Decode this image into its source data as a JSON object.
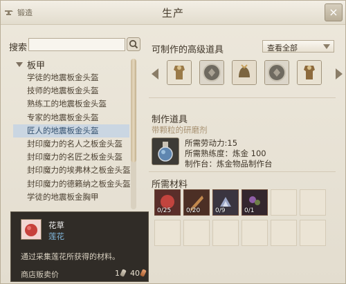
{
  "window": {
    "title": "生产",
    "tab_label": "锻造",
    "close_symbol": "×"
  },
  "search": {
    "label": "搜索",
    "value": "",
    "placeholder": ""
  },
  "list": {
    "category": "板甲",
    "items": [
      "学徒的地震板金头盔",
      "技师的地震板金头盔",
      "熟练工的地震板金头盔",
      "专家的地震板金头盔",
      "匠人的地震板金头盔",
      "封印魔力的名人之板金头盔",
      "封印魔力的名匠之板金头盔",
      "封印魔力的埃弗林之板金头盔",
      "封印魔力的德籁纳之板金头盔",
      "学徒的地震板金胸甲"
    ],
    "selected_index": 4
  },
  "craftable": {
    "title": "可制作的高级道具",
    "filter": {
      "selected": "查看全部"
    },
    "icons": [
      "armor-icon",
      "medal-icon",
      "helmet-icon",
      "medal-icon",
      "armor-icon"
    ]
  },
  "make": {
    "title": "制作道具",
    "item_name": "带颗粒的研磨剂",
    "item_icon": "potion-icon",
    "labor": "所需劳动力:15",
    "proficiency": "所需熟练度：炼金 100",
    "station": "制作台：炼金物品制作台"
  },
  "materials": {
    "title": "所需材料",
    "slots": [
      {
        "icon": "flower-icon",
        "qty": "0/25"
      },
      {
        "icon": "feather-icon",
        "qty": "0/20"
      },
      {
        "icon": "crystal-icon",
        "qty": "0/9"
      },
      {
        "icon": "herb-icon",
        "qty": "0/1"
      }
    ]
  },
  "tooltip": {
    "name": "花草",
    "subtitle": "莲花",
    "description": "通过采集莲花所获得的材料。",
    "price_label": "商店贩卖价",
    "price_silver": "1",
    "price_copper": "40"
  },
  "colors": {
    "selected_row": "#cad6e2",
    "accent_tan": "#a79171",
    "tooltip_bg": "#221e1a"
  }
}
